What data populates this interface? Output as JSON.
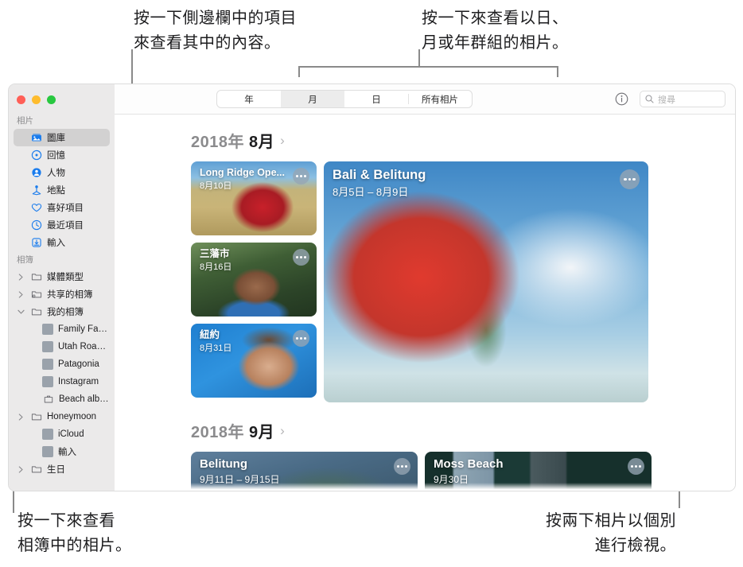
{
  "annotations": {
    "top_left": "按一下側邊欄中的項目\n來查看其中的內容。",
    "top_right": "按一下來查看以日、\n月或年群組的相片。",
    "bottom_left": "按一下來查看\n相簿中的相片。",
    "bottom_right": "按兩下相片以個別\n進行檢視。"
  },
  "window": {
    "traffic_lights": {
      "close": "close",
      "minimize": "minimize",
      "zoom": "zoom"
    }
  },
  "sidebar": {
    "sections": [
      {
        "title": "相片",
        "items": [
          {
            "label": "圖庫",
            "icon": "library-icon",
            "selected": true,
            "twisty": "none",
            "kind": "icon"
          },
          {
            "label": "回憶",
            "icon": "memories-icon",
            "selected": false,
            "twisty": "none",
            "kind": "icon"
          },
          {
            "label": "人物",
            "icon": "people-icon",
            "selected": false,
            "twisty": "none",
            "kind": "icon"
          },
          {
            "label": "地點",
            "icon": "places-icon",
            "selected": false,
            "twisty": "none",
            "kind": "icon"
          },
          {
            "label": "喜好項目",
            "icon": "heart-icon",
            "selected": false,
            "twisty": "none",
            "kind": "icon"
          },
          {
            "label": "最近項目",
            "icon": "clock-icon",
            "selected": false,
            "twisty": "none",
            "kind": "icon"
          },
          {
            "label": "輸入",
            "icon": "import-icon",
            "selected": false,
            "twisty": "none",
            "kind": "icon"
          }
        ]
      },
      {
        "title": "相簿",
        "items": [
          {
            "label": "媒體類型",
            "icon": "folder-icon",
            "selected": false,
            "twisty": "collapsed",
            "kind": "icon"
          },
          {
            "label": "共享的相簿",
            "icon": "shared-folder-icon",
            "selected": false,
            "twisty": "collapsed",
            "kind": "icon"
          },
          {
            "label": "我的相簿",
            "icon": "folder-icon",
            "selected": false,
            "twisty": "expanded",
            "kind": "icon"
          },
          {
            "label": "Family Family...",
            "icon": "album-thumb-family",
            "selected": false,
            "twisty": "none",
            "kind": "thumb",
            "thumb": "th-family",
            "indent": true
          },
          {
            "label": "Utah Roadtrip",
            "icon": "album-thumb-utah",
            "selected": false,
            "twisty": "none",
            "kind": "thumb",
            "thumb": "th-utah",
            "indent": true
          },
          {
            "label": "Patagonia",
            "icon": "album-thumb-patagonia",
            "selected": false,
            "twisty": "none",
            "kind": "thumb",
            "thumb": "th-patag",
            "indent": true
          },
          {
            "label": "Instagram",
            "icon": "album-thumb-instagram",
            "selected": false,
            "twisty": "none",
            "kind": "thumb",
            "thumb": "th-insta",
            "indent": true
          },
          {
            "label": "Beach album",
            "icon": "album-icon",
            "selected": false,
            "twisty": "none",
            "kind": "icon",
            "indent": true
          },
          {
            "label": "Honeymoon",
            "icon": "folder-icon",
            "selected": false,
            "twisty": "collapsed",
            "kind": "icon",
            "indent": false
          },
          {
            "label": "iCloud",
            "icon": "album-thumb-icloud",
            "selected": false,
            "twisty": "none",
            "kind": "thumb",
            "thumb": "th-icloud",
            "indent": true
          },
          {
            "label": "輸入",
            "icon": "album-thumb-import",
            "selected": false,
            "twisty": "none",
            "kind": "thumb",
            "thumb": "th-import",
            "indent": true
          },
          {
            "label": "生日",
            "icon": "folder-icon",
            "selected": false,
            "twisty": "collapsed",
            "kind": "icon",
            "indent": false
          }
        ]
      }
    ]
  },
  "toolbar": {
    "segments": [
      {
        "label": "年",
        "active": false
      },
      {
        "label": "月",
        "active": true
      },
      {
        "label": "日",
        "active": false
      },
      {
        "label": "所有相片",
        "active": false
      }
    ],
    "info_icon": "info-icon",
    "search": {
      "icon": "search-icon",
      "placeholder": "搜尋",
      "value": ""
    }
  },
  "groups": [
    {
      "year": "2018年",
      "month": "8月",
      "chevron": "›",
      "small_cards": [
        {
          "title": "Long Ridge Ope...",
          "date": "8月10日",
          "photo": "ph-longridge"
        },
        {
          "title": "三藩市",
          "date": "8月16日",
          "photo": "ph-sf"
        },
        {
          "title": "紐約",
          "date": "8月31日",
          "photo": "ph-ny"
        }
      ],
      "big_card": {
        "title": "Bali & Belitung",
        "date": "8月5日 – 8月9日",
        "photo": "ph-bali"
      }
    },
    {
      "year": "2018年",
      "month": "9月",
      "chevron": "›",
      "cards": [
        {
          "title": "Belitung",
          "date": "9月11日 – 9月15日",
          "photo": "ph-belitung"
        },
        {
          "title": "Moss Beach",
          "date": "9月30日",
          "photo": "ph-moss"
        }
      ]
    }
  ],
  "colors": {
    "accent_blue": "#1a7ced",
    "sidebar_bg": "#ebeaea",
    "selected_row": "#d2d1d1",
    "leader_line": "#8a8a8a",
    "text": "#1d1d1f"
  }
}
